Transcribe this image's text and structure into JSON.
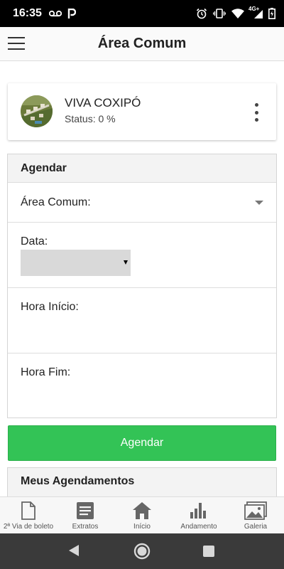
{
  "status_bar": {
    "time": "16:35",
    "network_label": "4G+",
    "icons": [
      "voicemail-icon",
      "parking-icon",
      "alarm-icon",
      "vibrate-icon",
      "wifi-icon",
      "signal-icon",
      "battery-icon"
    ]
  },
  "app_bar": {
    "menu_icon": "hamburger-menu-icon",
    "title": "Área Comum"
  },
  "project": {
    "name": "VIVA COXIPÓ",
    "status": "Status: 0 %",
    "menu_icon": "more-vertical-icon"
  },
  "form": {
    "header": "Agendar",
    "area_label": "Área Comum:",
    "date_label": "Data:",
    "date_value": "",
    "start_label": "Hora Início:",
    "end_label": "Hora Fim:"
  },
  "submit_label": "Agendar",
  "my_bookings_header": "Meus Agendamentos",
  "bottom_nav": [
    {
      "label": "2ª Via de boleto",
      "icon": "document-icon"
    },
    {
      "label": "Extratos",
      "icon": "list-icon"
    },
    {
      "label": "Início",
      "icon": "home-icon"
    },
    {
      "label": "Andamento",
      "icon": "bar-chart-icon"
    },
    {
      "label": "Galeria",
      "icon": "gallery-icon"
    }
  ],
  "colors": {
    "primary_button": "#33c356",
    "status_bar": "#000000",
    "system_nav": "#3a3a3a"
  }
}
